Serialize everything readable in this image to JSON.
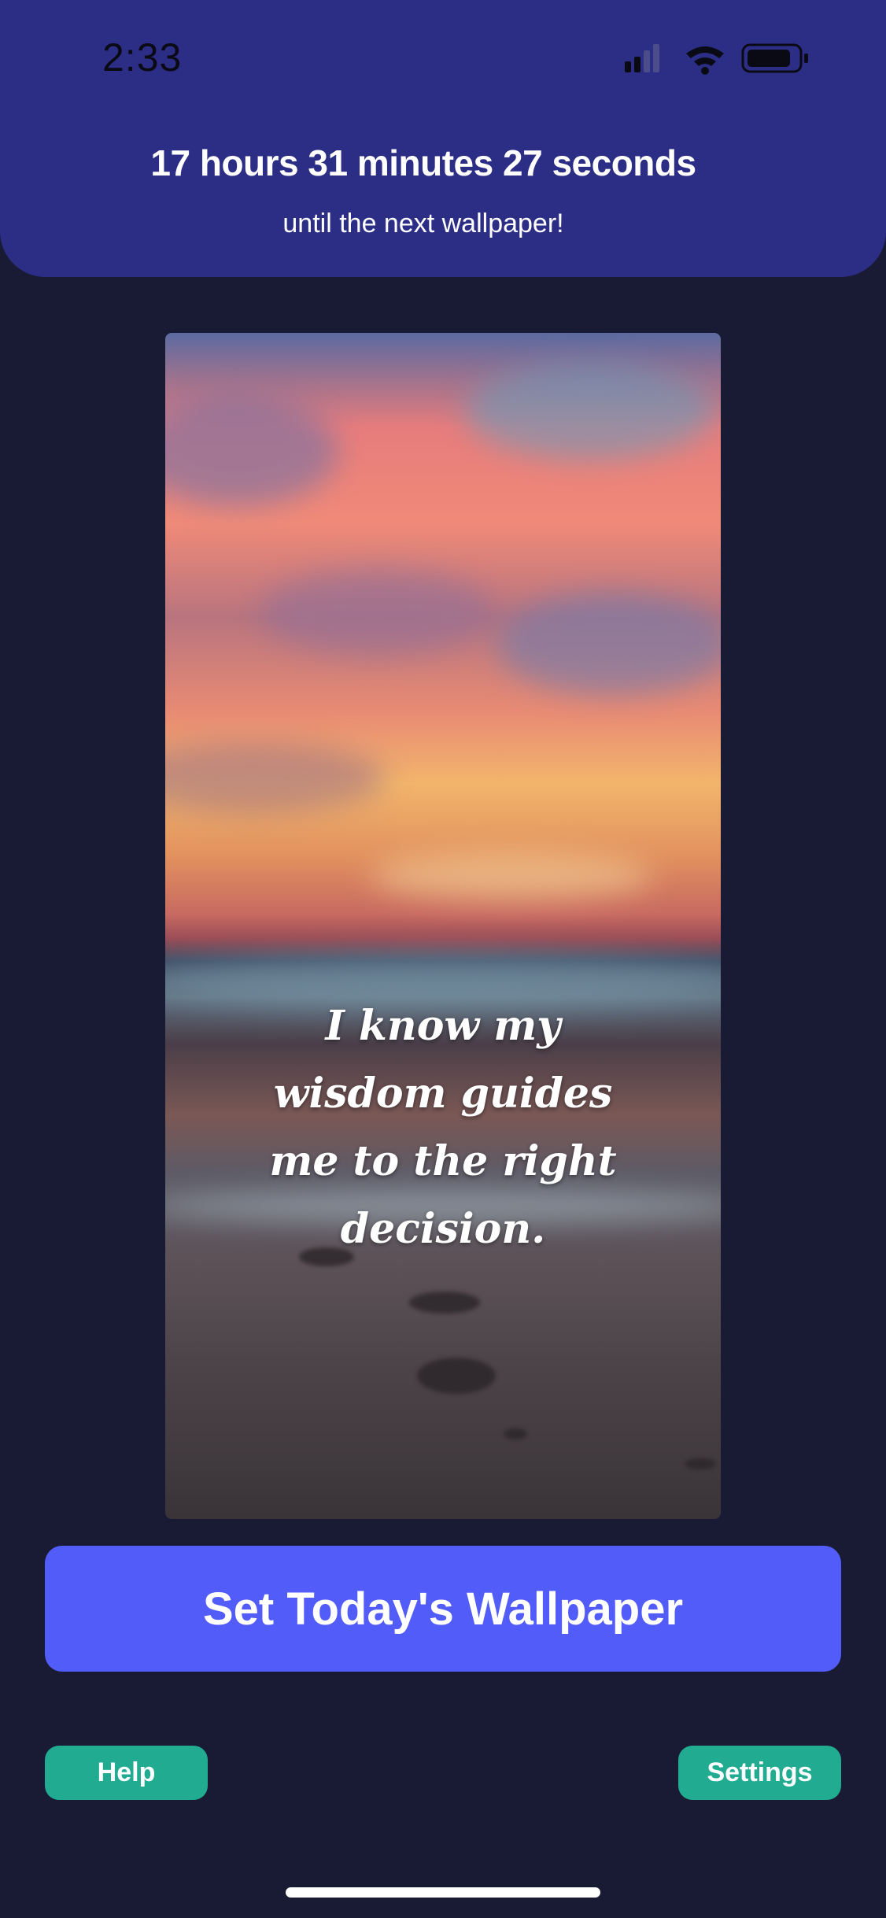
{
  "status_bar": {
    "time": "2:33",
    "icons": [
      "signal-icon",
      "wifi-icon",
      "battery-icon"
    ]
  },
  "countdown": {
    "time_remaining": "17 hours 31 minutes 27 seconds",
    "subtitle": "until the next wallpaper!"
  },
  "wallpaper": {
    "quote": "I know my wisdom guides me to the right decision."
  },
  "actions": {
    "set_wallpaper_label": "Set Today's Wallpaper",
    "help_label": "Help",
    "settings_label": "Settings"
  },
  "colors": {
    "background": "#191a33",
    "header": "#2c2e86",
    "primary_button": "#525cf9",
    "secondary_button": "#21ac91"
  }
}
